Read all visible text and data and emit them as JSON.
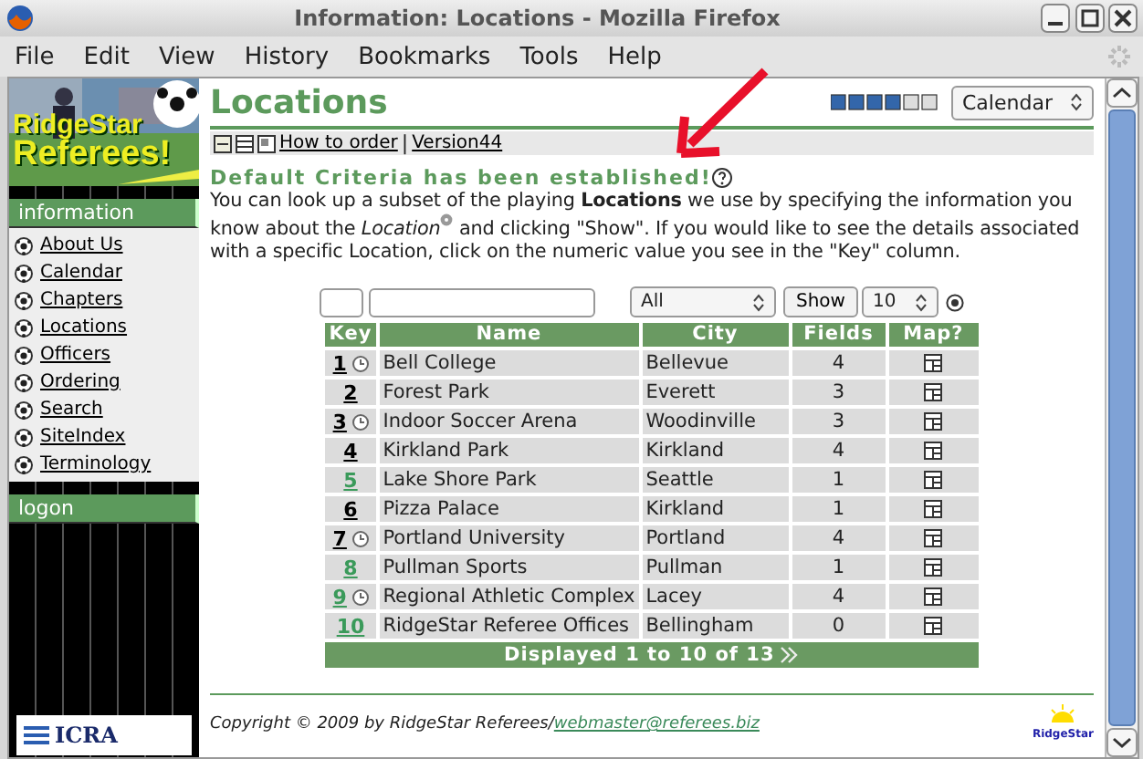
{
  "window": {
    "title": "Information: Locations - Mozilla Firefox"
  },
  "menu": [
    "File",
    "Edit",
    "View",
    "History",
    "Bookmarks",
    "Tools",
    "Help"
  ],
  "sidebar": {
    "logo_lines": [
      "RidgeStar",
      "Referees!"
    ],
    "sections": [
      {
        "title": "information",
        "items": [
          "About Us",
          "Calendar",
          "Chapters",
          "Locations",
          "Officers",
          "Ordering",
          "Search",
          "SiteIndex",
          "Terminology"
        ]
      },
      {
        "title": "logon"
      }
    ],
    "badge": "ICRA"
  },
  "page": {
    "title": "Locations",
    "jump_select": "Calendar",
    "links": [
      "How to order",
      "Version44"
    ],
    "link_separator": "|",
    "notice": "Default Criteria has been established!",
    "intro": "You can look up a subset of the playing **Locations** we use by specifying the information you know about the *Location*",
    "intro_rest": " and clicking \"Show\". If you would like to see the details associated with a specific Location, click on the numeric value you see in the \"Key\" column."
  },
  "filter": {
    "city": "All",
    "button": "Show",
    "page_size": "10"
  },
  "table": {
    "columns": [
      "Key",
      "Name",
      "City",
      "Fields",
      "Map?"
    ],
    "rows": [
      {
        "key": "1",
        "visited": true,
        "clock": true,
        "name": "Bell College",
        "city": "Bellevue",
        "fields": "4"
      },
      {
        "key": "2",
        "visited": true,
        "clock": false,
        "name": "Forest Park",
        "city": "Everett",
        "fields": "3"
      },
      {
        "key": "3",
        "visited": true,
        "clock": true,
        "name": "Indoor Soccer Arena",
        "city": "Woodinville",
        "fields": "3"
      },
      {
        "key": "4",
        "visited": true,
        "clock": false,
        "name": "Kirkland Park",
        "city": "Kirkland",
        "fields": "4"
      },
      {
        "key": "5",
        "visited": false,
        "clock": false,
        "name": "Lake Shore Park",
        "city": "Seattle",
        "fields": "1"
      },
      {
        "key": "6",
        "visited": true,
        "clock": false,
        "name": "Pizza Palace",
        "city": "Kirkland",
        "fields": "1"
      },
      {
        "key": "7",
        "visited": true,
        "clock": true,
        "name": "Portland University",
        "city": "Portland",
        "fields": "4"
      },
      {
        "key": "8",
        "visited": false,
        "clock": false,
        "name": "Pullman Sports",
        "city": "Pullman",
        "fields": "1"
      },
      {
        "key": "9",
        "visited": false,
        "clock": true,
        "name": "Regional Athletic Complex",
        "city": "Lacey",
        "fields": "4"
      },
      {
        "key": "10",
        "visited": false,
        "clock": false,
        "name": "RidgeStar Referee Offices",
        "city": "Bellingham",
        "fields": "0"
      }
    ],
    "footer": "Displayed 1 to 10 of 13"
  },
  "footer": {
    "copyright": "Copyright © 2009 by RidgeStar Referees/",
    "email": "webmaster@referees.biz",
    "logo": "RidgeStar"
  }
}
